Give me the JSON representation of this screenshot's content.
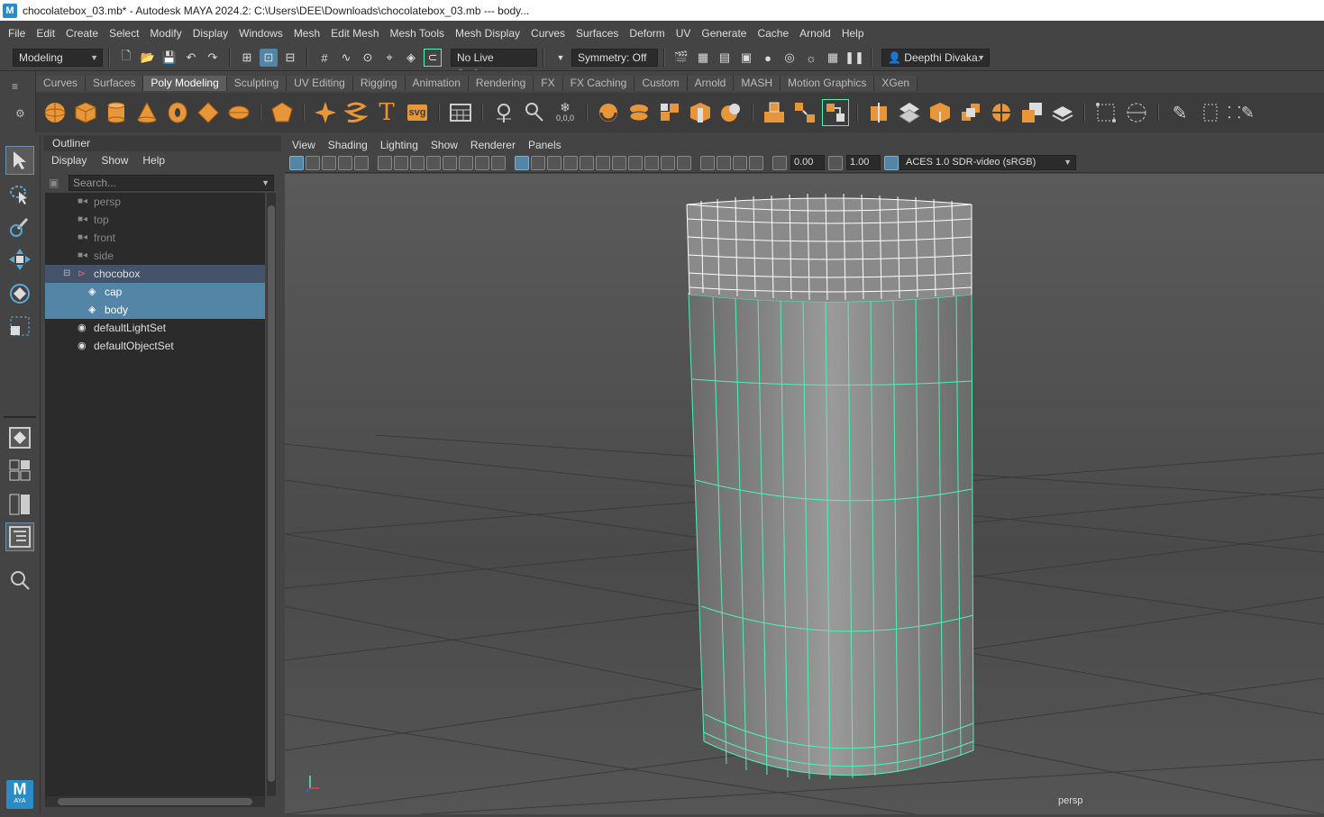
{
  "titlebar": {
    "title": "chocolatebox_03.mb* - Autodesk MAYA 2024.2: C:\\Users\\DEE\\Downloads\\chocolatebox_03.mb   ---   body..."
  },
  "menubar": [
    "File",
    "Edit",
    "Create",
    "Select",
    "Modify",
    "Display",
    "Windows",
    "Mesh",
    "Edit Mesh",
    "Mesh Tools",
    "Mesh Display",
    "Curves",
    "Surfaces",
    "Deform",
    "UV",
    "Generate",
    "Cache",
    "Arnold",
    "Help"
  ],
  "statusline": {
    "mode": "Modeling",
    "live_surface": "No Live Surface",
    "symmetry": "Symmetry: Off",
    "user": "Deepthi Divaka."
  },
  "shelf": {
    "tabs": [
      "Curves",
      "Surfaces",
      "Poly Modeling",
      "Sculpting",
      "UV Editing",
      "Rigging",
      "Animation",
      "Rendering",
      "FX",
      "FX Caching",
      "Custom",
      "Arnold",
      "MASH",
      "Motion Graphics",
      "XGen"
    ],
    "selected": "Poly Modeling",
    "icon_names": [
      "sphere-icon",
      "cube-icon",
      "cylinder-icon",
      "cone-icon",
      "torus-icon",
      "plane-icon",
      "disc-icon",
      "platonic-icon",
      "superellipse-icon",
      "type-icon",
      "svg-icon",
      "grid-icon",
      "sculpt-icon",
      "measure-icon",
      "snow-icon",
      "combine-icon",
      "separate-icon",
      "smooth-icon",
      "extrude-icon",
      "bevel-icon",
      "bridge-icon",
      "append-icon",
      "multicut-icon",
      "target-weld-icon",
      "mirror-icon"
    ],
    "svg_label": "svg",
    "origin_label": "0,0,0"
  },
  "outliner": {
    "title": "Outliner",
    "menu": [
      "Display",
      "Show",
      "Help"
    ],
    "search_placeholder": "Search...",
    "items": [
      "persp",
      "top",
      "front",
      "side",
      "chocobox",
      "cap",
      "body",
      "defaultLightSet",
      "defaultObjectSet"
    ]
  },
  "viewport": {
    "menu": [
      "View",
      "Shading",
      "Lighting",
      "Show",
      "Renderer",
      "Panels"
    ],
    "field1": "0.00",
    "field2": "1.00",
    "colorspace": "ACES 1.0 SDR-video (sRGB)",
    "camera": "persp"
  },
  "toolbox": {
    "logo": "M",
    "logo_sub": "AYA"
  },
  "colors": {
    "selection": "#5285a6",
    "wire_selected": "#4ef2b4",
    "wire_white": "#ffffff"
  }
}
